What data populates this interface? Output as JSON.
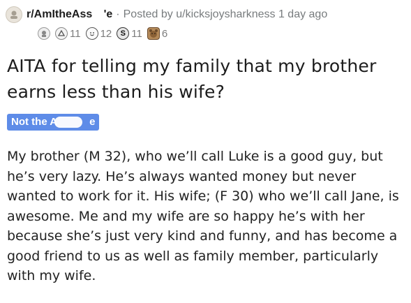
{
  "header": {
    "subreddit_visible": "r/AmItheAss",
    "subreddit_suffix": "'e",
    "separator": "·",
    "posted_by": "Posted by u/kicksjoysharkness 1 day ago"
  },
  "awards": [
    {
      "icon": "award-silver-icon",
      "count": ""
    },
    {
      "icon": "award-helpful-icon",
      "count": "11"
    },
    {
      "icon": "award-wholesome-icon",
      "count": "12"
    },
    {
      "icon": "award-coin-icon",
      "count": "11"
    },
    {
      "icon": "award-bear-icon",
      "count": "6"
    }
  ],
  "title": "AITA for telling my family that my brother earns less than his wife?",
  "flair": {
    "label": "Not the A",
    "suffix": "e",
    "color": "#5e8ce8"
  },
  "body": "My brother (M 32), who we’ll call Luke is a good guy, but he’s very lazy. He’s always wanted money but never wanted to work for it. His wife; (F 30) who we’ll call Jane, is awesome. Me and my wife are so happy he’s with her because she’s just very kind and funny, and has become a good friend to us as well as family member, particularly with my wife."
}
